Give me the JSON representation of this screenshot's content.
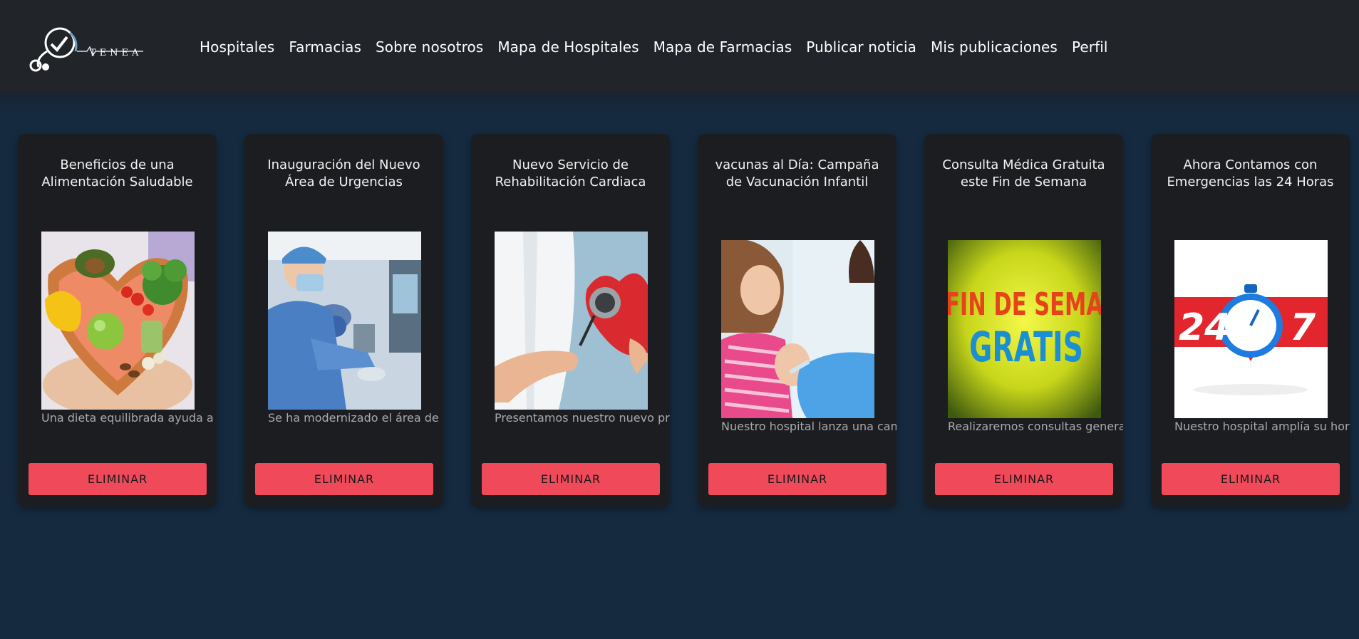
{
  "nav": {
    "brand": "TENEA",
    "links": [
      "Hospitales",
      "Farmacias",
      "Sobre nosotros",
      "Mapa de Hospitales",
      "Mapa de Farmacias",
      "Publicar noticia",
      "Mis publicaciones",
      "Perfil"
    ]
  },
  "cards": [
    {
      "title": "Beneficios de una Alimentación Saludable",
      "description": "Una dieta equilibrada ayuda a pr",
      "button": "ELIMINAR",
      "image": "healthy-food-heart-image"
    },
    {
      "title": "Inauguración del Nuevo Área de Urgencias",
      "description": "Se ha modernizado el área de ur",
      "button": "ELIMINAR",
      "image": "surgeon-operating-room-image"
    },
    {
      "title": "Nuevo Servicio de Rehabilitación Cardiaca",
      "description": "Presentamos nuestro nuevo pro",
      "button": "ELIMINAR",
      "image": "stethoscope-heart-image"
    },
    {
      "title": "vacunas al Día: Campaña de Vacunación Infantil",
      "description": "Nuestro hospital lanza una cam",
      "button": "ELIMINAR",
      "image": "child-vaccination-image"
    },
    {
      "title": "Consulta Médica Gratuita este Fin de Semana",
      "description": "Realizaremos consultas general",
      "button": "ELIMINAR",
      "image": "fin-de-semana-gratis-image",
      "image_text": [
        "FIN DE SEMA",
        "GRATIS"
      ]
    },
    {
      "title": "Ahora Contamos con Emergencias las 24 Horas",
      "description": "Nuestro hospital amplía su hora",
      "button": "ELIMINAR",
      "image": "24-7-stopwatch-image",
      "image_text": [
        "24",
        "7"
      ]
    }
  ],
  "colors": {
    "navbar": "#212428",
    "background": "#152a3f",
    "card": "#1c1d20",
    "button": "#f04a5a"
  }
}
